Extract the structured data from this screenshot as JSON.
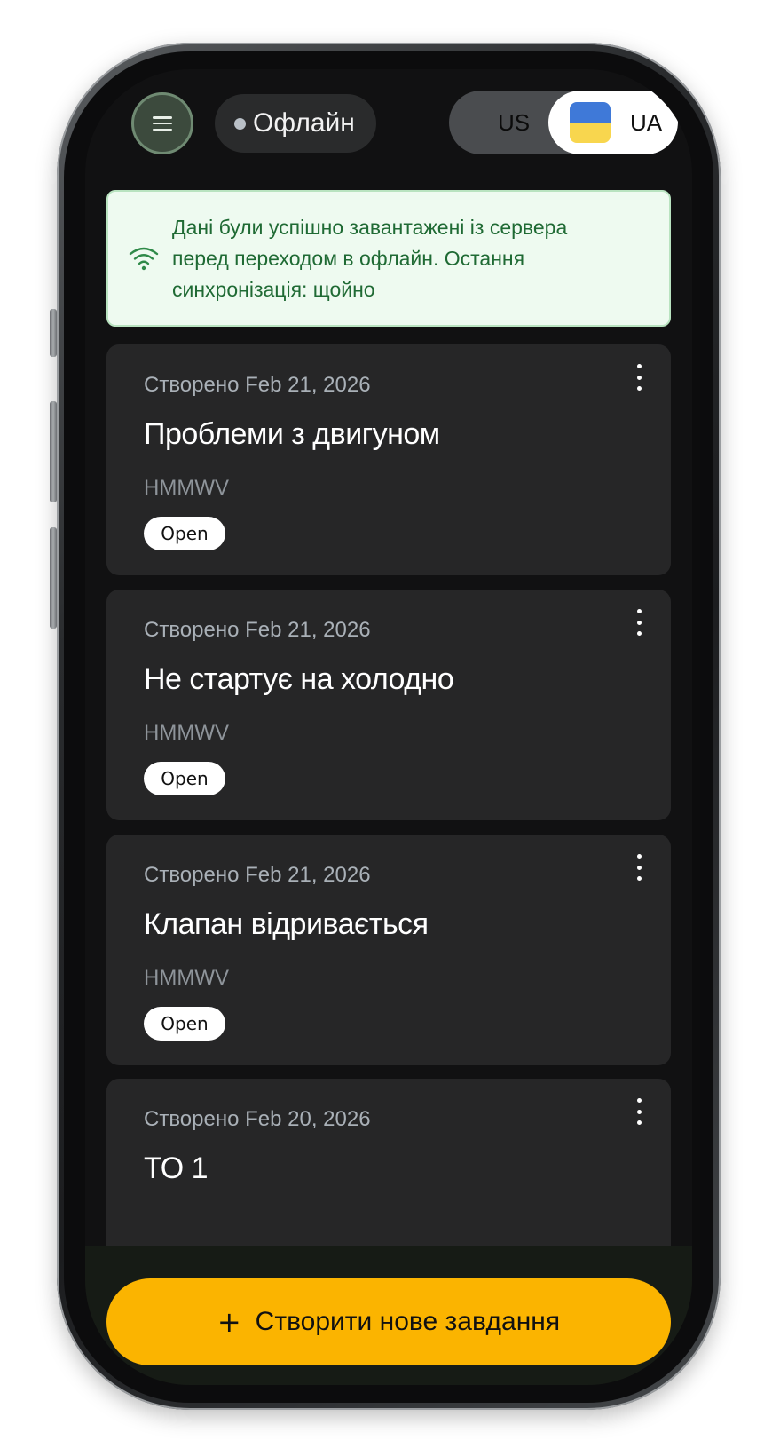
{
  "header": {
    "status": "Офлайн",
    "lang_us": "US",
    "lang_ua": "UA"
  },
  "sync_banner": {
    "line1": "Дані були успішно завантажені із сервера",
    "line2": "перед переходом в офлайн. Остання",
    "line3": "синхронізація: щойно"
  },
  "tasks": [
    {
      "date": "Створено Feb 21, 2026",
      "title": "Проблеми з двигуном",
      "vehicle": "HMMWV",
      "status": "Open"
    },
    {
      "date": "Створено Feb 21, 2026",
      "title": "Не стартує на холодно",
      "vehicle": "HMMWV",
      "status": "Open"
    },
    {
      "date": "Створено Feb 21, 2026",
      "title": "Клапан відривається",
      "vehicle": "HMMWV",
      "status": "Open"
    },
    {
      "date": "Створено Feb 20, 2026",
      "title": "ТО 1",
      "vehicle": "",
      "status": ""
    }
  ],
  "create_button": {
    "icon": "+",
    "label": "Створити нове завдання"
  },
  "colors": {
    "accent": "#fbb400",
    "banner_text": "#1f6a34",
    "banner_bg": "#eefaf0",
    "card_bg": "#262627"
  }
}
